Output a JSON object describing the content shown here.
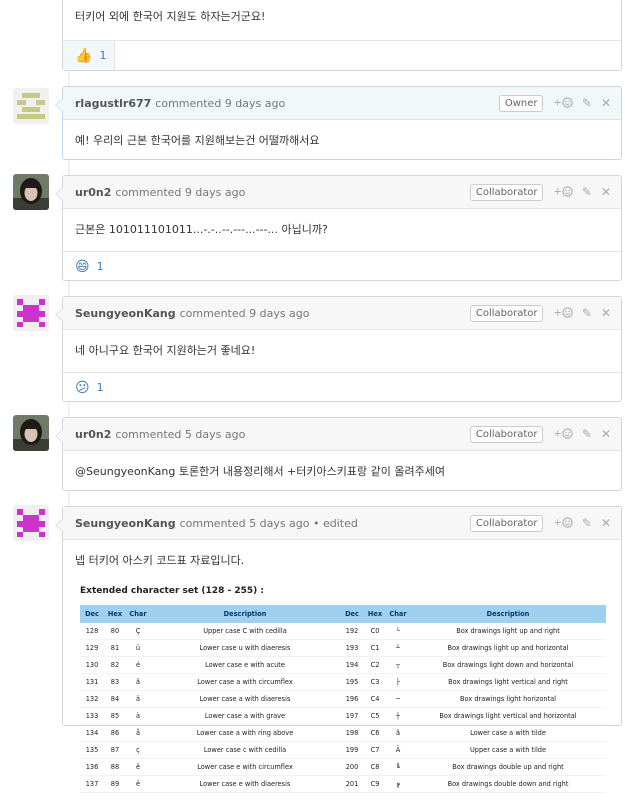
{
  "comments": [
    {
      "id": "c0",
      "body": "터키어 외에 한국어 지원도 하자는거군요!",
      "reactions": [
        {
          "emoji": "👍",
          "count": "1"
        }
      ]
    },
    {
      "id": "c1",
      "author": "rlagustlr677",
      "meta": "commented 9 days ago",
      "role": "Owner",
      "body": "예! 우리의 근본 한국어를 지원해보는건 어떨까해서요"
    },
    {
      "id": "c2",
      "author": "ur0n2",
      "meta": "commented 9 days ago",
      "role": "Collaborator",
      "body": "근본은 101011101011...-.-..--.---...---... 아닙니까?",
      "reactions": [
        {
          "emoji": "😄",
          "count": "1"
        }
      ]
    },
    {
      "id": "c3",
      "author": "SeungyeonKang",
      "meta": "commented 9 days ago",
      "role": "Collaborator",
      "body": "네 아니구요 한국어 지원하는거 좋네요!",
      "reactions": [
        {
          "emoji": "😕",
          "count": "1"
        }
      ]
    },
    {
      "id": "c4",
      "author": "ur0n2",
      "meta": "commented 5 days ago",
      "role": "Collaborator",
      "body": "@SeungyeonKang 토론한거 내용정리해서 +터키아스키표랑 같이 올려주세여"
    },
    {
      "id": "c5",
      "author": "SeungyeonKang",
      "meta": "commented 5 days ago • edited",
      "role": "Collaborator",
      "body": "넵 터키어 아스키 코드표 자료입니다."
    }
  ],
  "ascii_table": {
    "title": "Extended character set (128 - 255) :",
    "headers": [
      "Dec",
      "Hex",
      "Char",
      "Description",
      "Dec",
      "Hex",
      "Char",
      "Description"
    ],
    "rows": [
      [
        "128",
        "80",
        "Ç",
        "Upper case C with cedilla",
        "192",
        "C0",
        "└",
        "Box drawings light up and right"
      ],
      [
        "129",
        "81",
        "ü",
        "Lower case u with diaeresis",
        "193",
        "C1",
        "┴",
        "Box drawings light up and horizontal"
      ],
      [
        "130",
        "82",
        "é",
        "Lower case e with acute",
        "194",
        "C2",
        "┬",
        "Box drawings light down and horizontal"
      ],
      [
        "131",
        "83",
        "â",
        "Lower case a with circumflex",
        "195",
        "C3",
        "├",
        "Box drawings light vertical and right"
      ],
      [
        "132",
        "84",
        "ä",
        "Lower case a with diaeresis",
        "196",
        "C4",
        "─",
        "Box drawings light horizontal"
      ],
      [
        "133",
        "85",
        "à",
        "Lower case a with grave",
        "197",
        "C5",
        "┼",
        "Box drawings light vertical and horizontal"
      ],
      [
        "134",
        "86",
        "å",
        "Lower case a with ring above",
        "198",
        "C6",
        "ã",
        "Lower case a with tilde"
      ],
      [
        "135",
        "87",
        "ç",
        "Lower case c with cedilla",
        "199",
        "C7",
        "Ã",
        "Upper case a with tilde"
      ],
      [
        "136",
        "88",
        "ê",
        "Lower case e with circumflex",
        "200",
        "C8",
        "╚",
        "Box drawings double up and right"
      ],
      [
        "137",
        "89",
        "ë",
        "Lower case e with diaeresis",
        "201",
        "C9",
        "╔",
        "Box drawings double down and right"
      ]
    ]
  },
  "icons": {
    "add_reaction": "+😊",
    "edit": "pencil-icon",
    "delete": "close-icon"
  },
  "colors": {
    "owner_header_bg": "#f2f8fa",
    "owner_border": "#bfd8eb",
    "header_bg": "#f7f7f7",
    "link_blue": "#4078c0",
    "table_header_bg": "#9fd0ef"
  }
}
